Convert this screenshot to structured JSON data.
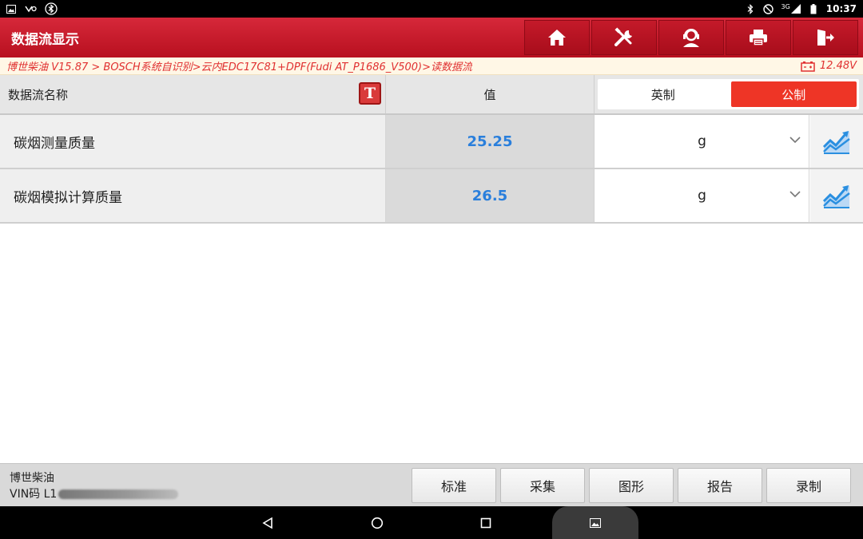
{
  "status_bar": {
    "left_icons": [
      "image-icon",
      "voicemail-icon",
      "bluetooth-circle-icon"
    ],
    "right_icons": [
      "bluetooth-icon",
      "do-not-disturb-icon",
      "signal-icon",
      "battery-icon"
    ],
    "network": "3G",
    "time": "10:37"
  },
  "titlebar": {
    "title": "数据流显示",
    "buttons": [
      "home-icon",
      "diagnostic-tools-icon",
      "remote-support-icon",
      "print-icon",
      "exit-icon"
    ]
  },
  "breadcrumb": {
    "path": "博世柴油 V15.87 > BOSCH系统自识别>云内EDC17C81+DPF(Fudi AT_P1686_V500)>读数据流",
    "voltage": "12.48V"
  },
  "table": {
    "name_header": "数据流名称",
    "t_icon_label": "T",
    "value_header": "值",
    "units_toggle": {
      "imperial": "英制",
      "metric": "公制",
      "selected": "metric"
    },
    "rows": [
      {
        "name": "碳烟测量质量",
        "value": "25.25",
        "unit": "g"
      },
      {
        "name": "碳烟模拟计算质量",
        "value": "26.5",
        "unit": "g"
      }
    ]
  },
  "bottom": {
    "vehicle_name": "博世柴油",
    "vin_label": "VIN码 L1",
    "buttons": [
      "标准",
      "采集",
      "图形",
      "报告",
      "录制"
    ]
  },
  "colors": {
    "brand_red": "#c41a2a",
    "accent_red": "#ee3526",
    "value_blue": "#2a7fdc",
    "graph_blue": "#2a8fe0"
  }
}
